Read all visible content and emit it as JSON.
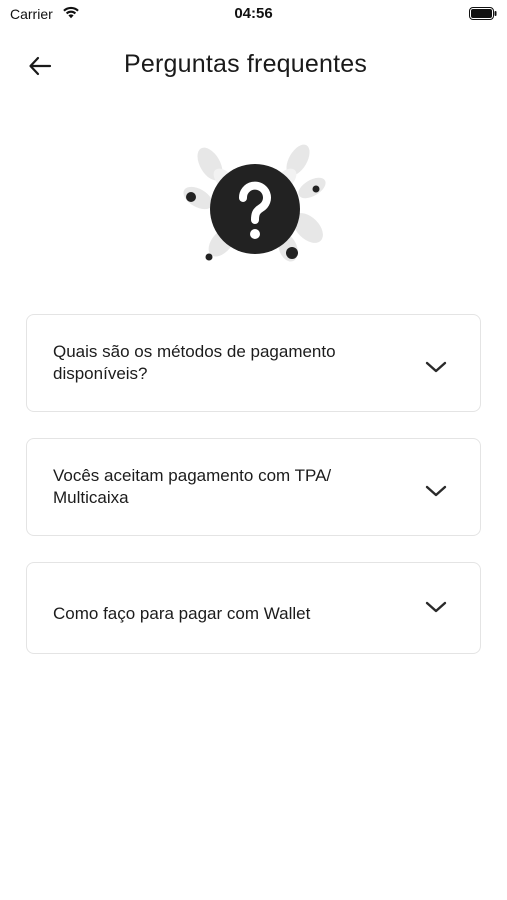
{
  "status_bar": {
    "carrier": "Carrier",
    "time": "04:56"
  },
  "header": {
    "title": "Perguntas frequentes",
    "back_icon": "arrow-left-icon"
  },
  "illustration": {
    "icon": "question-mark-icon"
  },
  "faq": {
    "items": [
      {
        "question": "Quais são os métodos de pagamento disponíveis?",
        "icon": "chevron-down-icon"
      },
      {
        "question": "Vocês aceitam pagamento com TPA/ Multicaixa",
        "icon": "chevron-down-icon"
      },
      {
        "question": "Como faço para pagar com Wallet",
        "icon": "chevron-down-icon"
      }
    ]
  },
  "colors": {
    "text": "#1c1c1c",
    "border": "#e4e4e4",
    "badge": "#222222"
  }
}
